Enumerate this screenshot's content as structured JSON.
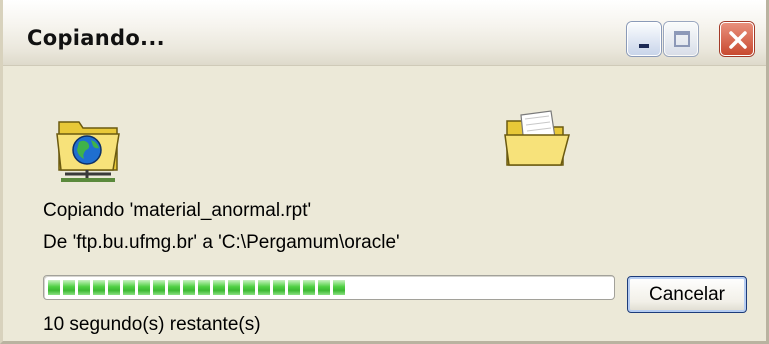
{
  "window": {
    "title": "Copiando...",
    "controls": {
      "minimize": "minimize-icon",
      "maximize": "maximize-icon",
      "close": "close-icon"
    }
  },
  "icons": {
    "source": "network-folder-icon",
    "destination": "open-folder-icon"
  },
  "status": {
    "copying_line": "Copiando 'material_anormal.rpt'",
    "path_line": "De 'ftp.bu.ufmg.br' a 'C:\\Pergamum\\oracle'",
    "time_remaining": "10 segundo(s) restante(s)"
  },
  "progress": {
    "fraction": 0.55
  },
  "buttons": {
    "cancel_label": "Cancelar"
  },
  "colors": {
    "progress_green": "#3cb833",
    "window_background": "#ece9d8",
    "close_red": "#c84a30"
  }
}
